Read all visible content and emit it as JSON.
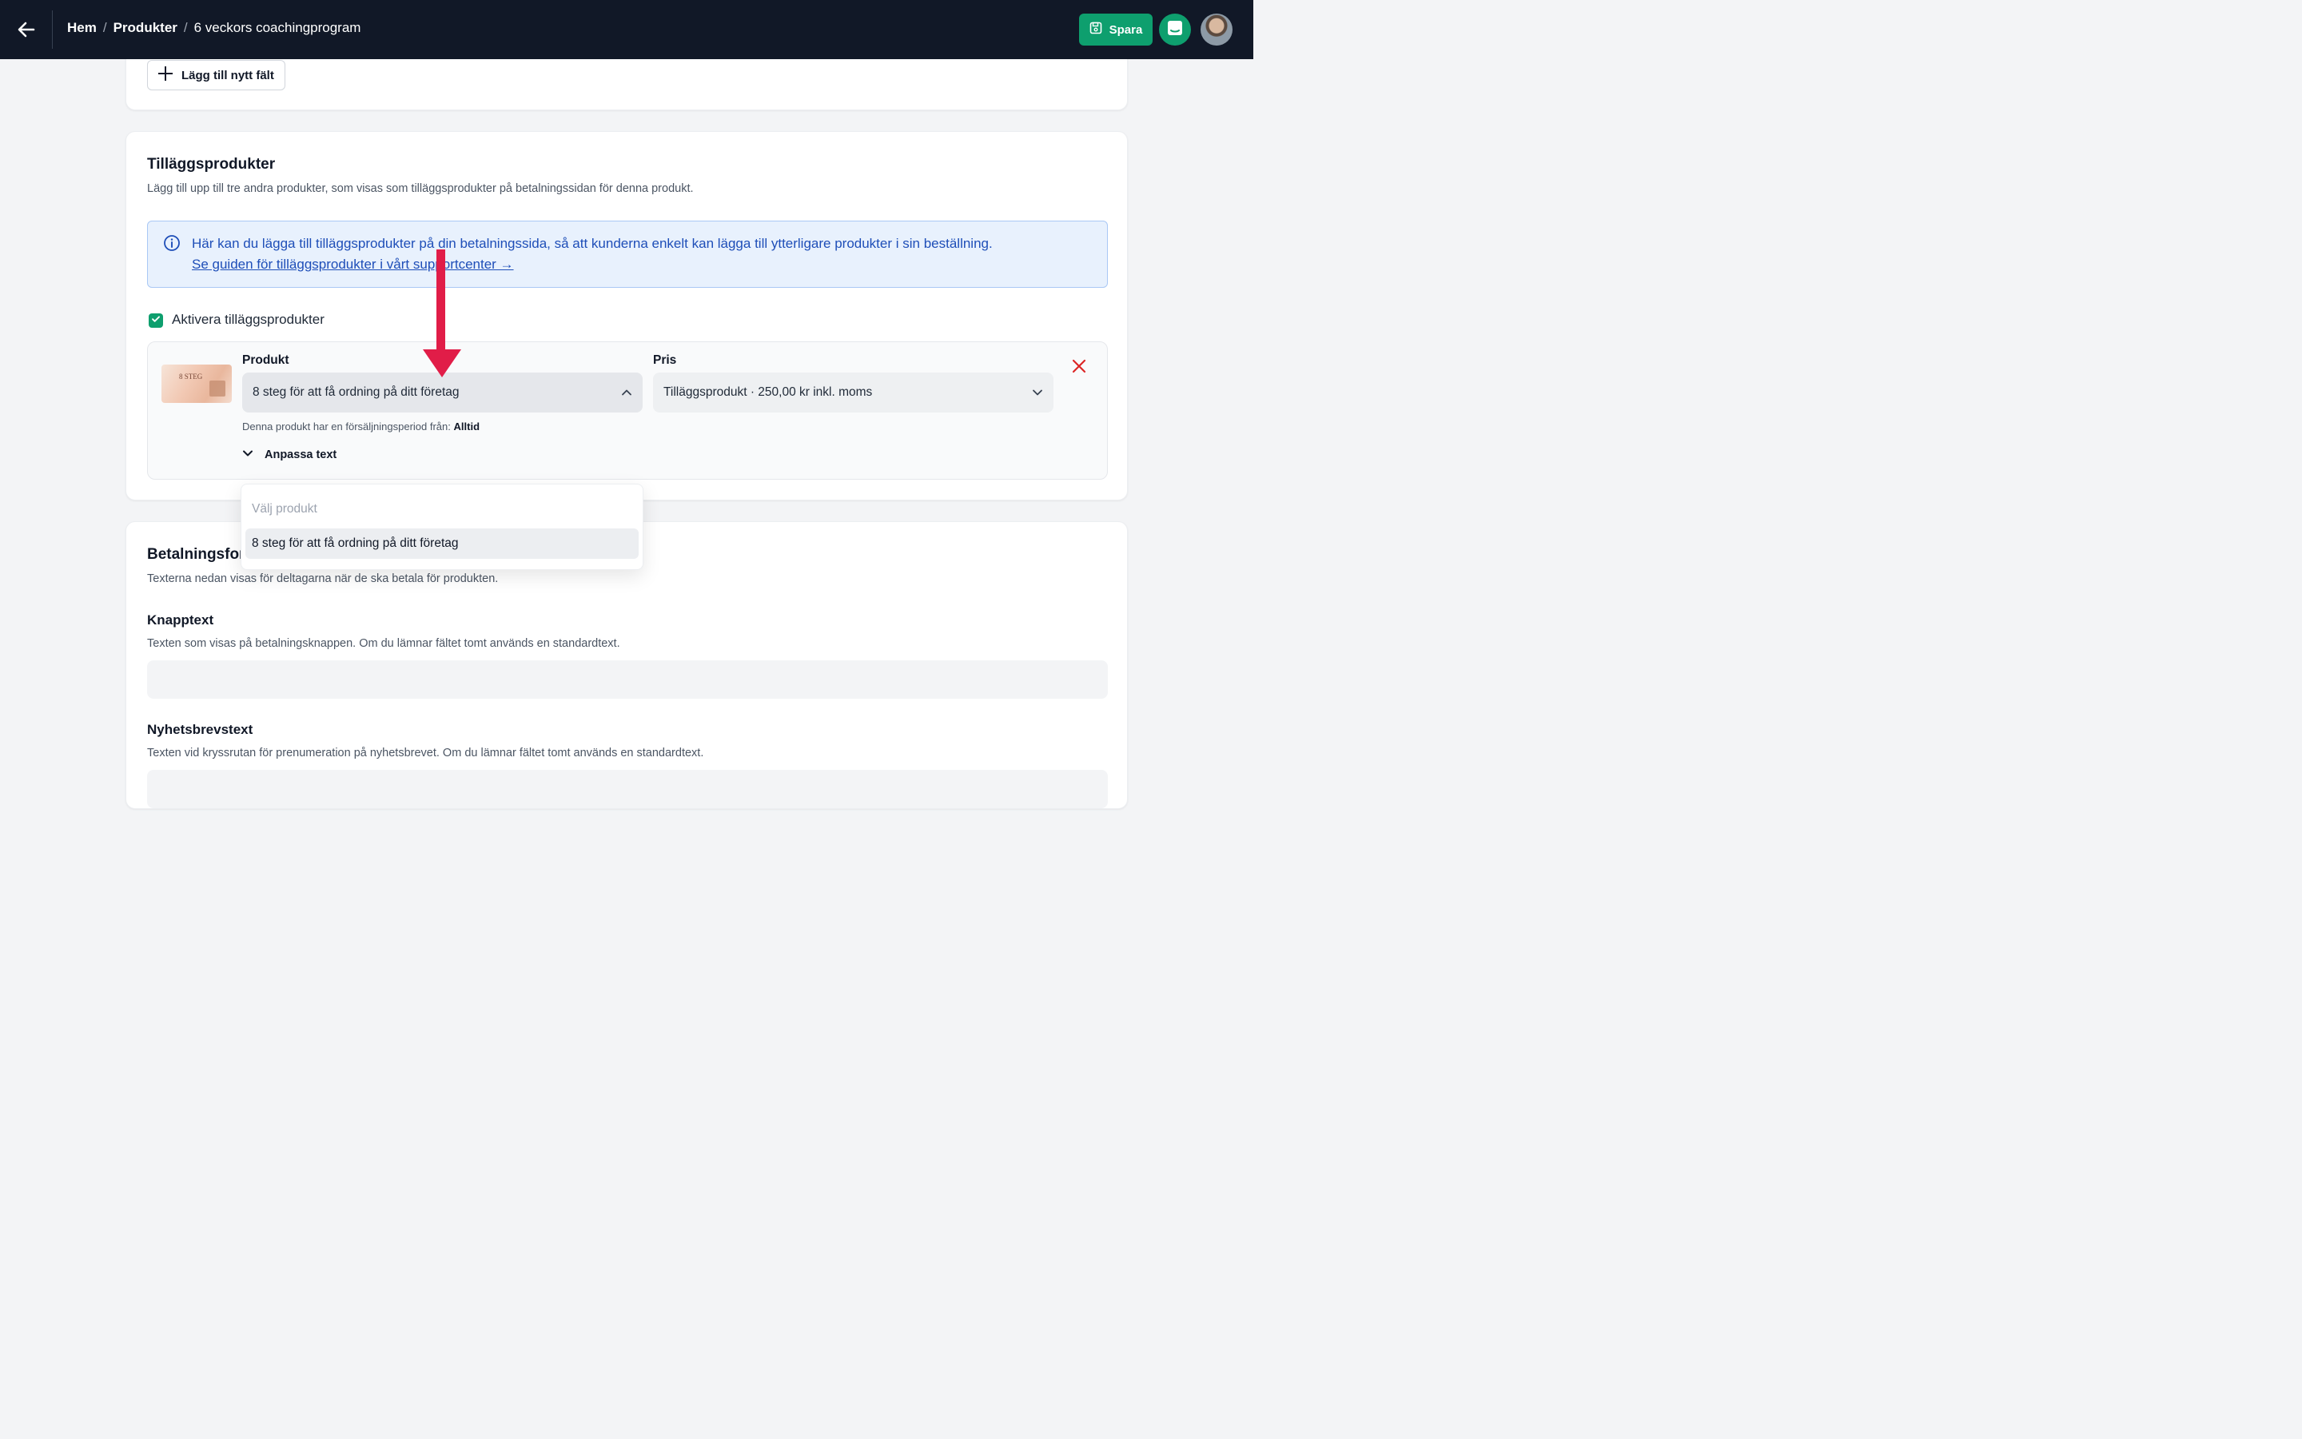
{
  "topbar": {
    "breadcrumb": [
      "Hem",
      "Produkter",
      "6 veckors coachingprogram"
    ],
    "breadcrumb_sep": "/",
    "save_label": "Spara",
    "accent_color": "#0e9f6e"
  },
  "custom_fields": {
    "add_field_label": "Lägg till nytt fält"
  },
  "addons": {
    "title": "Tilläggsprodukter",
    "description": "Lägg till upp till tre andra produkter, som visas som tilläggsprodukter på betalningssidan för denna produkt.",
    "info_text": "Här kan du lägga till tilläggsprodukter på din betalningssida, så att kunderna enkelt kan lägga till ytterligare produkter i sin beställning.",
    "info_link": "Se guiden för tilläggsprodukter i vårt supportcenter →",
    "enable_label": "Aktivera tilläggsprodukter",
    "enabled": true,
    "item": {
      "thumbnail_text": "8 STEG",
      "product_label": "Produkt",
      "product_value": "8 steg för att få ordning på ditt företag",
      "price_label": "Pris",
      "price_value": "Tilläggsprodukt · 250,00 kr inkl. moms",
      "sale_period_prefix": "Denna produkt har en försäljningsperiod från:",
      "sale_period_value": "Alltid",
      "customize_label": "Anpassa text"
    },
    "dropdown": {
      "placeholder": "Välj produkt",
      "options": [
        "8 steg för att få ordning på ditt företag"
      ]
    }
  },
  "payment_form": {
    "title": "Betalningsformulär",
    "description": "Texterna nedan visas för deltagarna när de ska betala för produkten.",
    "button_text": {
      "label": "Knapptext",
      "help": "Texten som visas på betalningsknappen. Om du lämnar fältet tomt används en standardtext."
    },
    "newsletter_text": {
      "label": "Nyhetsbrevstext",
      "help": "Texten vid kryssrutan för prenumeration på nyhetsbrevet. Om du lämnar fältet tomt används en standardtext."
    }
  }
}
